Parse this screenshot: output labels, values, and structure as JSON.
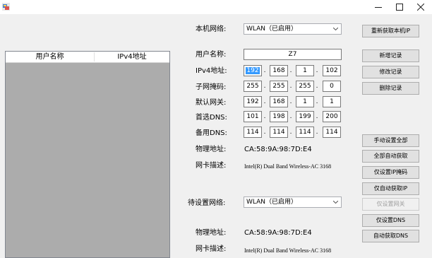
{
  "window": {
    "icon": "network-app-icon",
    "controls": [
      "minimize",
      "maximize",
      "close"
    ]
  },
  "list": {
    "columns": [
      "用户名称",
      "IPv4地址"
    ],
    "rows": []
  },
  "local": {
    "network_label": "本机网络:",
    "network_value": "WLAN（已启用）",
    "mac_label": "物理地址:",
    "mac_value": "CA:58:9A:98:7D:E4",
    "desc_label": "网卡描述:",
    "desc_value": "Intel(R) Dual Band Wireless-AC 3168"
  },
  "form": {
    "username_label": "用户名称:",
    "username_value": "Z7",
    "ipv4_label": "IPv4地址:",
    "ipv4": [
      "192",
      "168",
      "1",
      "102"
    ],
    "mask_label": "子网掩码:",
    "mask": [
      "255",
      "255",
      "255",
      "0"
    ],
    "gateway_label": "默认网关:",
    "gateway": [
      "192",
      "168",
      "1",
      "1"
    ],
    "dns1_label": "首选DNS:",
    "dns1": [
      "101",
      "198",
      "199",
      "200"
    ],
    "dns2_label": "备用DNS:",
    "dns2": [
      "114",
      "114",
      "114",
      "114"
    ]
  },
  "target": {
    "network_label": "待设置网络:",
    "network_value": "WLAN（已启用）",
    "mac_label": "物理地址:",
    "mac_value": "CA:58:9A:98:7D:E4",
    "desc_label": "网卡描述:",
    "desc_value": "Intel(R) Dual Band Wireless-AC 3168"
  },
  "buttons": {
    "refresh_ip": "重新获取本机IP",
    "add_record": "新增记录",
    "edit_record": "修改记录",
    "delete_record": "删除记录",
    "manual_all": "手动设置全部",
    "auto_all": "全部自动获取",
    "only_ip_mask": "仅设置IP掩码",
    "auto_ip": "仅自动获取IP",
    "set_gateway": "仅设置网关",
    "only_dns": "仅设置DNS",
    "auto_dns": "自动获取DNS"
  },
  "colors": {
    "window_bg": "#f0f0f0",
    "list_bg": "#acacac",
    "selection": "#3399ff",
    "button_bg": "#e1e1e1"
  }
}
